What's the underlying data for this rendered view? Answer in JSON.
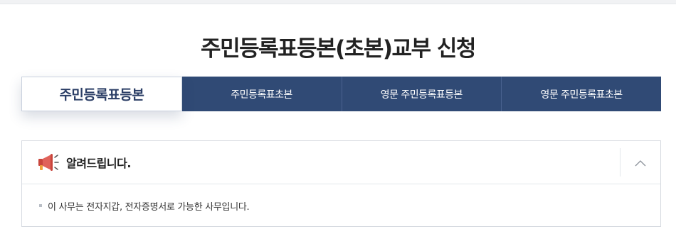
{
  "page": {
    "title": "주민등록표등본(초본)교부 신청"
  },
  "tabs": [
    {
      "label": "주민등록표등본",
      "active": true
    },
    {
      "label": "주민등록표초본",
      "active": false
    },
    {
      "label": "영문 주민등록표등본",
      "active": false
    },
    {
      "label": "영문 주민등록표초본",
      "active": false
    }
  ],
  "notice": {
    "title": "알려드립니다.",
    "icon": "megaphone-icon",
    "collapse_icon": "chevron-up-icon",
    "items": [
      "이 사무는 전자지갑, 전자증명서로 가능한 사무입니다."
    ]
  },
  "colors": {
    "tab_bg": "#304a75",
    "tab_active_text": "#2b3e66",
    "megaphone_red": "#d9534f"
  }
}
